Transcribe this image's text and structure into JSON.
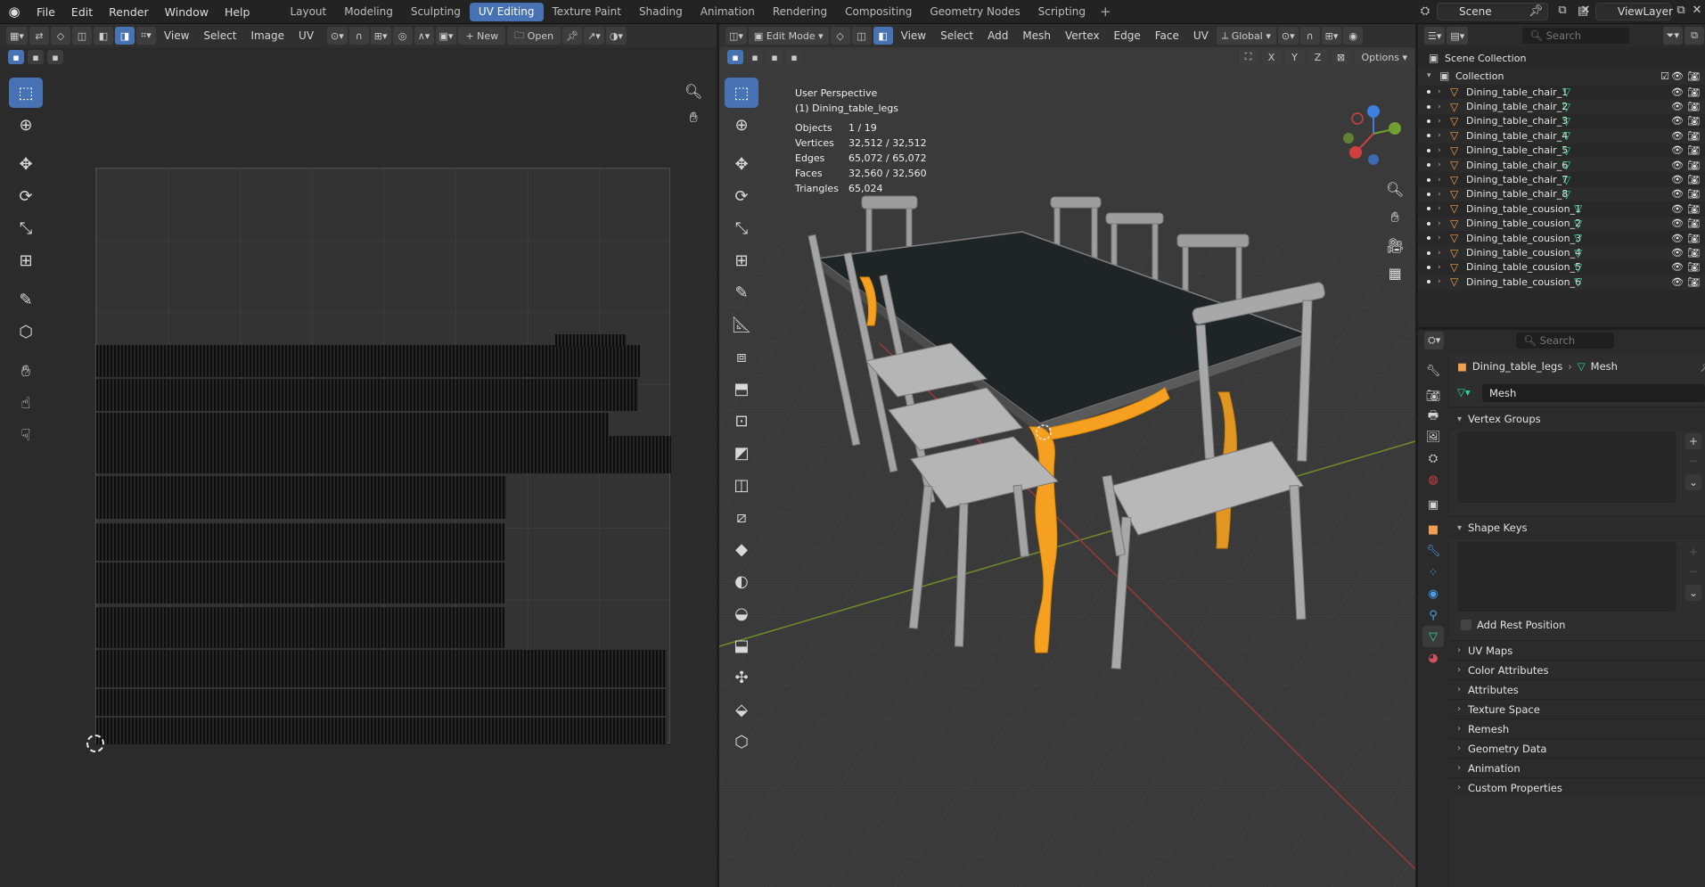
{
  "menu": [
    "File",
    "Edit",
    "Render",
    "Window",
    "Help"
  ],
  "workspaces": [
    {
      "label": "Layout",
      "active": false
    },
    {
      "label": "Modeling",
      "active": false
    },
    {
      "label": "Sculpting",
      "active": false
    },
    {
      "label": "UV Editing",
      "active": true
    },
    {
      "label": "Texture Paint",
      "active": false
    },
    {
      "label": "Shading",
      "active": false
    },
    {
      "label": "Animation",
      "active": false
    },
    {
      "label": "Rendering",
      "active": false
    },
    {
      "label": "Compositing",
      "active": false
    },
    {
      "label": "Geometry Nodes",
      "active": false
    },
    {
      "label": "Scripting",
      "active": false
    }
  ],
  "scene": {
    "name": "Scene",
    "view_layer": "ViewLayer"
  },
  "uv_editor": {
    "menus": [
      "View",
      "Select",
      "Image",
      "UV"
    ],
    "new_label": "New",
    "open_label": "Open"
  },
  "viewport": {
    "mode": "Edit Mode",
    "menus": [
      "View",
      "Select",
      "Add",
      "Mesh",
      "Vertex",
      "Edge",
      "Face",
      "UV"
    ],
    "orientation": "Global",
    "axes": [
      "X",
      "Y",
      "Z"
    ],
    "options_label": "Options",
    "view_name": "User Perspective",
    "object_name": "(1) Dining_table_legs",
    "stats": [
      {
        "label": "Objects",
        "value": "1 / 19"
      },
      {
        "label": "Vertices",
        "value": "32,512 / 32,512"
      },
      {
        "label": "Edges",
        "value": "65,072 / 65,072"
      },
      {
        "label": "Faces",
        "value": "32,560 / 32,560"
      },
      {
        "label": "Triangles",
        "value": "65,024"
      }
    ],
    "gizmo_axes": [
      "Z",
      "Y",
      "X"
    ]
  },
  "outliner": {
    "search_placeholder": "Search",
    "root": "Scene Collection",
    "collection": "Collection",
    "items": [
      "Dining_table_chair_1",
      "Dining_table_chair_2",
      "Dining_table_chair_3",
      "Dining_table_chair_4",
      "Dining_table_chair_5",
      "Dining_table_chair_6",
      "Dining_table_chair_7",
      "Dining_table_chair_8",
      "Dining_table_cousion_1",
      "Dining_table_cousion_2",
      "Dining_table_cousion_3",
      "Dining_table_cousion_4",
      "Dining_table_cousion_5",
      "Dining_table_cousion_6"
    ]
  },
  "properties": {
    "search_placeholder": "Search",
    "breadcrumb_object": "Dining_table_legs",
    "breadcrumb_data": "Mesh",
    "mesh_name": "Mesh",
    "vertex_groups": "Vertex Groups",
    "shape_keys": "Shape Keys",
    "add_rest_position": "Add Rest Position",
    "sections": [
      "UV Maps",
      "Color Attributes",
      "Attributes",
      "Texture Space",
      "Remesh",
      "Geometry Data",
      "Animation",
      "Custom Properties"
    ]
  },
  "colors": {
    "accent": "#4772b3",
    "selection_orange": "#f5a020",
    "mesh_green": "#2fd890",
    "object_orange": "#f0a050"
  }
}
